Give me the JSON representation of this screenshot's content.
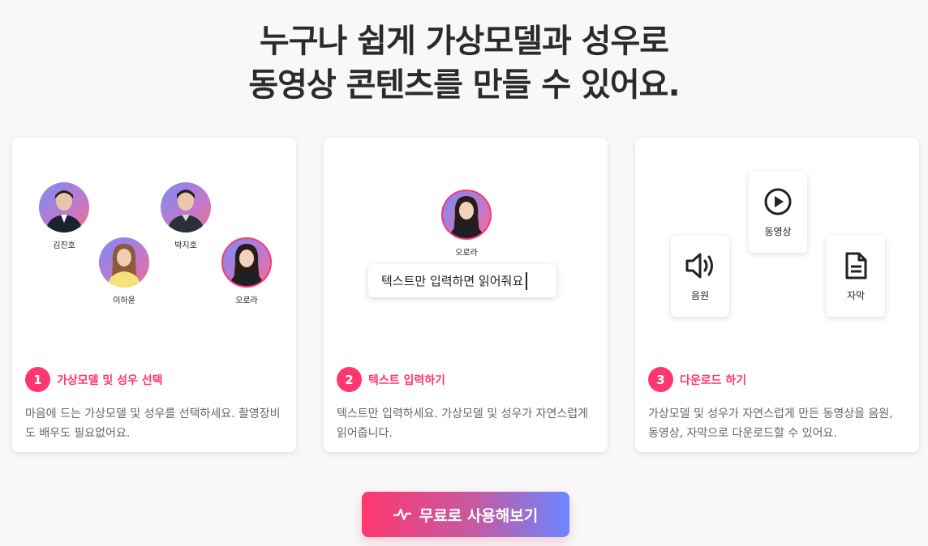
{
  "headline": {
    "line1": "누구나 쉽게 가상모델과 성우로",
    "line2": "동영상 콘텐츠를 만들 수 있어요."
  },
  "cards": [
    {
      "avatars": [
        {
          "name": "김진호",
          "icon": "male-avatar-icon"
        },
        {
          "name": "박지호",
          "icon": "male-avatar-icon"
        },
        {
          "name": "이하윤",
          "icon": "female-avatar-icon"
        },
        {
          "name": "오로라",
          "icon": "female-avatar-icon",
          "selected": true
        }
      ],
      "step_number": "1",
      "step_title": "가상모델 및 성우 선택",
      "step_desc": "마음에 드는 가상모델 및 성우를 선택하세요. 촬영장비도 배우도 필요없어요."
    },
    {
      "avatar": {
        "name": "오로라",
        "icon": "female-avatar-icon"
      },
      "input_text": "텍스트만 입력하면 읽어줘요",
      "step_number": "2",
      "step_title": "텍스트 입력하기",
      "step_desc": "텍스트만 입력하세요. 가상모델 및 성우가 자연스럽게 읽어줍니다."
    },
    {
      "tiles": [
        {
          "label": "동영상",
          "icon": "play-icon"
        },
        {
          "label": "음원",
          "icon": "speaker-icon"
        },
        {
          "label": "자막",
          "icon": "document-icon"
        }
      ],
      "step_number": "3",
      "step_title": "다운로드 하기",
      "step_desc": "가상모델 및 성우가 자연스럽게 만든 동영상을 음원, 동영상, 자막으로 다운로드할 수 있어요."
    }
  ],
  "cta": {
    "label": "무료로 사용해보기",
    "icon": "activity-pulse-icon"
  },
  "colors": {
    "accent": "#ff3770",
    "gradient_end": "#6b86ff"
  }
}
